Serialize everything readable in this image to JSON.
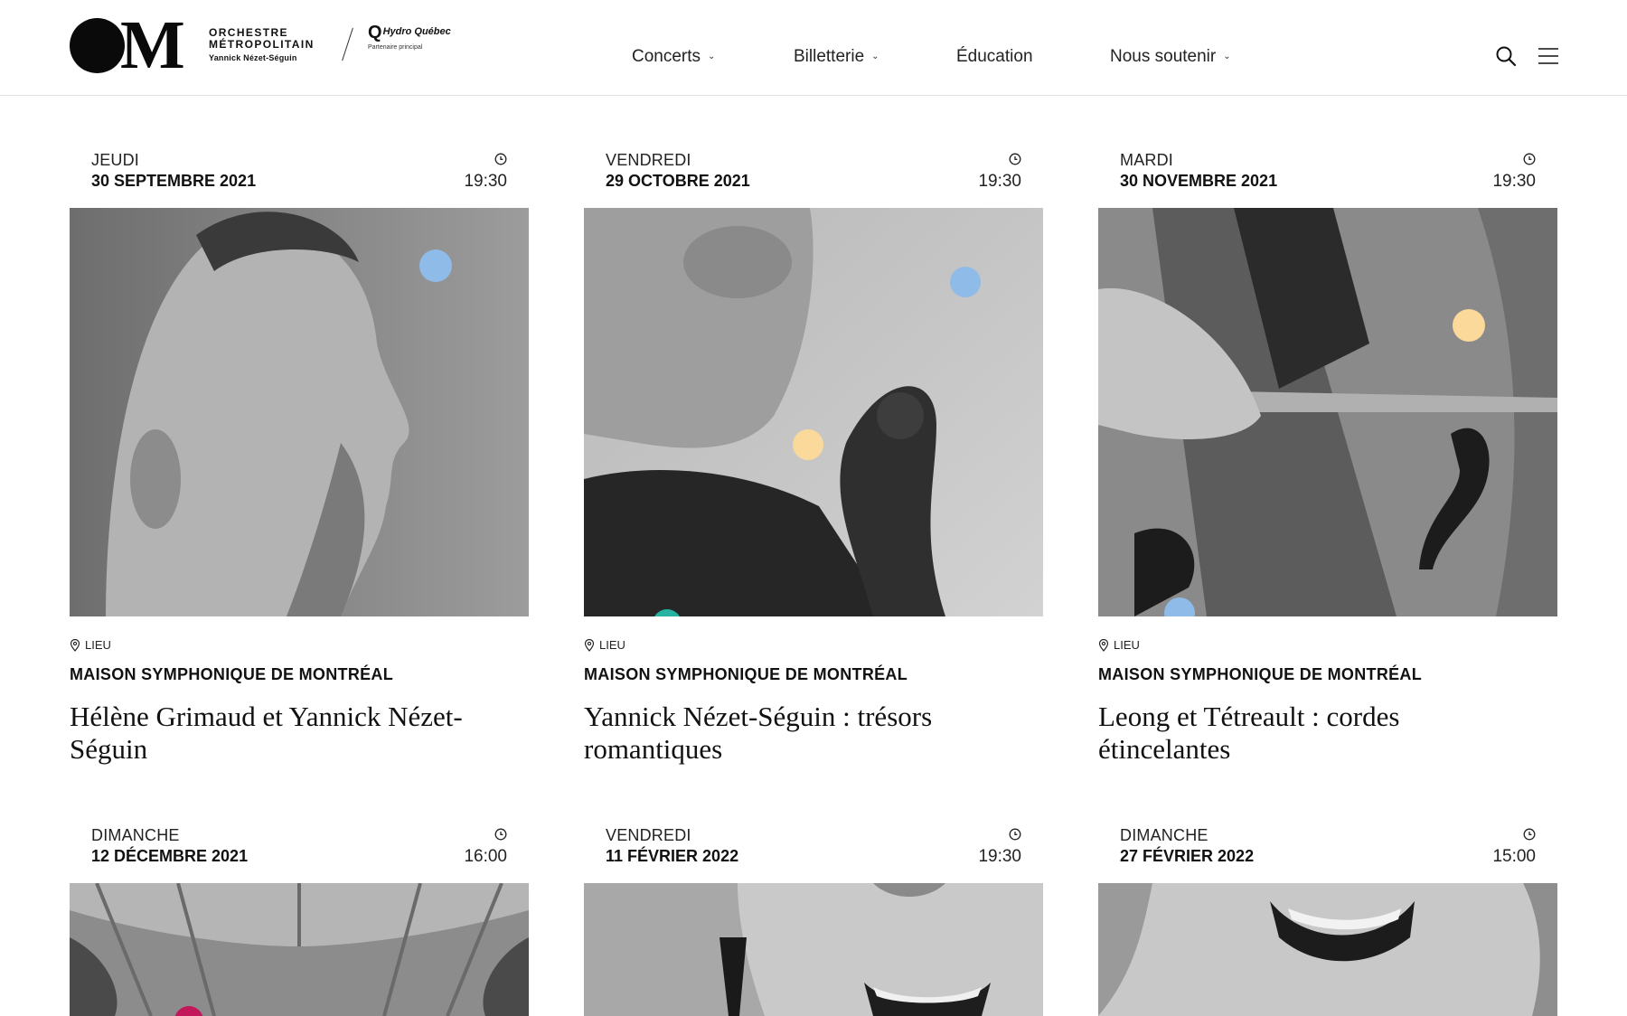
{
  "header": {
    "logo_letter": "M",
    "brand_line1": "ORCHESTRE",
    "brand_line2": "MÉTROPOLITAIN",
    "brand_line3": "Yannick Nézet-Séguin",
    "partner_q": "Q",
    "partner_name": "Hydro Québec",
    "partner_sub": "Partenaire principal"
  },
  "nav": {
    "items": [
      {
        "label": "Concerts",
        "dropdown": true
      },
      {
        "label": "Billetterie",
        "dropdown": true
      },
      {
        "label": "Éducation",
        "dropdown": false
      },
      {
        "label": "Nous soutenir",
        "dropdown": true
      }
    ],
    "chevron": "⌄"
  },
  "icons": {
    "search": "search-icon",
    "menu": "hamburger-menu-icon",
    "clock": "clock-icon",
    "pin": "location-pin-icon"
  },
  "colors": {
    "dot_blue": "#8fbbe8",
    "dot_yellow": "#fbd99a",
    "dot_teal": "#26b3a1",
    "dot_pink": "#c2185b"
  },
  "lieu_label": "LIEU",
  "concerts": [
    {
      "day": "JEUDI",
      "date": "30 SEPTEMBRE 2021",
      "time": "19:30",
      "venue": "MAISON SYMPHONIQUE DE MONTRÉAL",
      "title": "Hélène Grimaud et Yannick Nézet-Séguin"
    },
    {
      "day": "VENDREDI",
      "date": "29 OCTOBRE 2021",
      "time": "19:30",
      "venue": "MAISON SYMPHONIQUE DE MONTRÉAL",
      "title": "Yannick Nézet-Séguin : trésors romantiques"
    },
    {
      "day": "MARDI",
      "date": "30 NOVEMBRE 2021",
      "time": "19:30",
      "venue": "MAISON SYMPHONIQUE DE MONTRÉAL",
      "title": "Leong et Tétreault : cordes étincelantes"
    },
    {
      "day": "DIMANCHE",
      "date": "12 DÉCEMBRE 2021",
      "time": "16:00"
    },
    {
      "day": "VENDREDI",
      "date": "11 FÉVRIER 2022",
      "time": "19:30"
    },
    {
      "day": "DIMANCHE",
      "date": "27 FÉVRIER 2022",
      "time": "15:00"
    }
  ]
}
